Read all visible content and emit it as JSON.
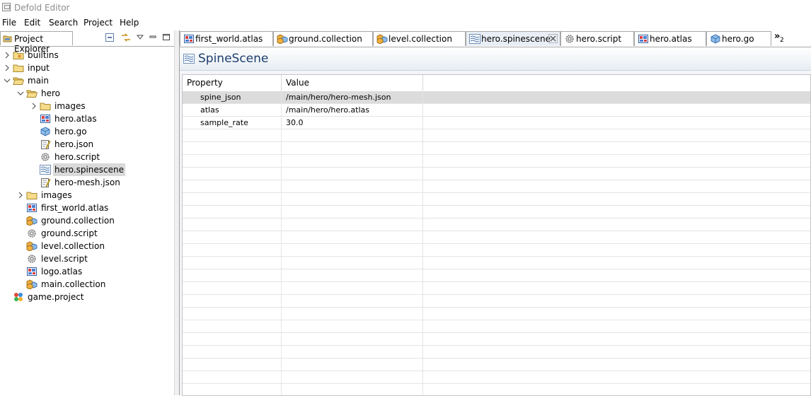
{
  "window": {
    "title": "Defold Editor"
  },
  "menu": [
    "File",
    "Edit",
    "Search",
    "Project",
    "Help"
  ],
  "explorer": {
    "tab_label": "Project Explorer",
    "tree": [
      {
        "label": "builtins",
        "depth": 0,
        "chevron": "right",
        "icon": "folder-builtins-icon",
        "selected": false
      },
      {
        "label": "input",
        "depth": 0,
        "chevron": "right",
        "icon": "folder-icon",
        "selected": false
      },
      {
        "label": "main",
        "depth": 0,
        "chevron": "down",
        "icon": "folder-open-icon",
        "selected": false
      },
      {
        "label": "hero",
        "depth": 1,
        "chevron": "down",
        "icon": "folder-open-icon",
        "selected": false
      },
      {
        "label": "images",
        "depth": 2,
        "chevron": "right",
        "icon": "folder-icon",
        "selected": false
      },
      {
        "label": "hero.atlas",
        "depth": 2,
        "chevron": "",
        "icon": "atlas-icon",
        "selected": false
      },
      {
        "label": "hero.go",
        "depth": 2,
        "chevron": "",
        "icon": "gameobject-icon",
        "selected": false
      },
      {
        "label": "hero.json",
        "depth": 2,
        "chevron": "",
        "icon": "json-icon",
        "selected": false
      },
      {
        "label": "hero.script",
        "depth": 2,
        "chevron": "",
        "icon": "script-gear-icon",
        "selected": false
      },
      {
        "label": "hero.spinescene",
        "depth": 2,
        "chevron": "",
        "icon": "spinescene-icon",
        "selected": true
      },
      {
        "label": "hero-mesh.json",
        "depth": 2,
        "chevron": "",
        "icon": "json-icon",
        "selected": false
      },
      {
        "label": "images",
        "depth": 1,
        "chevron": "right",
        "icon": "folder-icon",
        "selected": false
      },
      {
        "label": "first_world.atlas",
        "depth": 1,
        "chevron": "",
        "icon": "atlas-icon",
        "selected": false
      },
      {
        "label": "ground.collection",
        "depth": 1,
        "chevron": "",
        "icon": "collection-icon",
        "selected": false
      },
      {
        "label": "ground.script",
        "depth": 1,
        "chevron": "",
        "icon": "script-gear-icon",
        "selected": false
      },
      {
        "label": "level.collection",
        "depth": 1,
        "chevron": "",
        "icon": "collection-icon",
        "selected": false
      },
      {
        "label": "level.script",
        "depth": 1,
        "chevron": "",
        "icon": "script-gear-icon",
        "selected": false
      },
      {
        "label": "logo.atlas",
        "depth": 1,
        "chevron": "",
        "icon": "atlas-icon",
        "selected": false
      },
      {
        "label": "main.collection",
        "depth": 1,
        "chevron": "",
        "icon": "collection-icon",
        "selected": false
      },
      {
        "label": "game.project",
        "depth": 0,
        "chevron": "",
        "icon": "project-icon",
        "selected": false
      }
    ]
  },
  "editor_tabs": [
    {
      "label": "first_world.atlas",
      "icon": "atlas-icon",
      "active": false,
      "closable": false
    },
    {
      "label": "ground.collection",
      "icon": "collection-icon",
      "active": false,
      "closable": false
    },
    {
      "label": "level.collection",
      "icon": "collection-icon",
      "active": false,
      "closable": false
    },
    {
      "label": "hero.spinescene",
      "icon": "spinescene-icon",
      "active": true,
      "closable": true
    },
    {
      "label": "hero.script",
      "icon": "script-gear-icon",
      "active": false,
      "closable": false
    },
    {
      "label": "hero.atlas",
      "icon": "atlas-icon",
      "active": false,
      "closable": false
    },
    {
      "label": "hero.go",
      "icon": "gameobject-icon",
      "active": false,
      "closable": false
    }
  ],
  "more_tabs": {
    "count": "2",
    "glyph": "»"
  },
  "editor": {
    "title": "SpineScene",
    "columns": [
      "Property",
      "Value"
    ],
    "rows": [
      {
        "property": "spine_json",
        "value": "/main/hero/hero-mesh.json",
        "selected": true
      },
      {
        "property": "atlas",
        "value": "/main/hero/hero.atlas",
        "selected": false
      },
      {
        "property": "sample_rate",
        "value": "30.0",
        "selected": false
      }
    ]
  }
}
